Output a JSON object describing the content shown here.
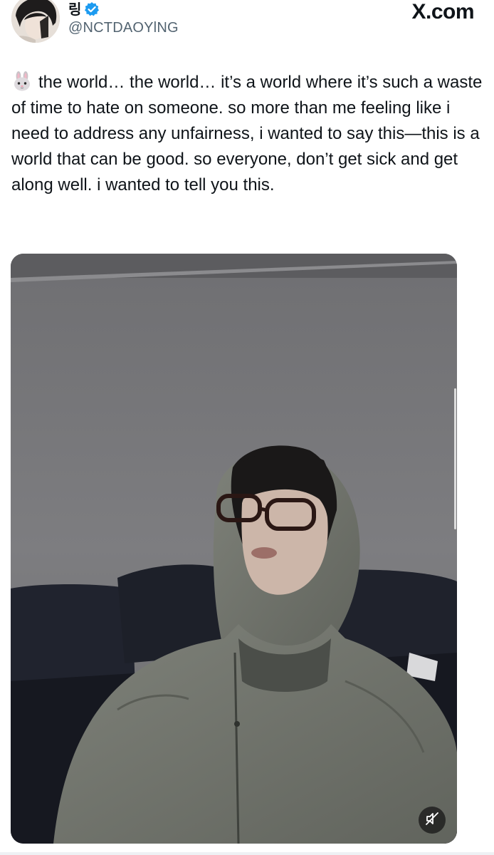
{
  "author": {
    "display_name": "링",
    "handle": "@NCTDAOYlNG",
    "verified": true,
    "avatar_icon": "profile-photo"
  },
  "site": {
    "label": "X.com"
  },
  "tweet": {
    "emoji_icon": "rabbit-face-icon",
    "text": "the world… the world… it’s a world where it’s such a waste of time to hate on someone. so more than me feeling like i need to address any unfairness, i wanted to say this—this is a world that can be good. so everyone, don’t get sick and get along well. i wanted to tell you this."
  },
  "media": {
    "type": "video",
    "controls": {
      "mute_icon": "speaker-muted-icon"
    }
  },
  "colors": {
    "text": "#0f1419",
    "secondary": "#536471",
    "verified": "#1d9bf0"
  }
}
